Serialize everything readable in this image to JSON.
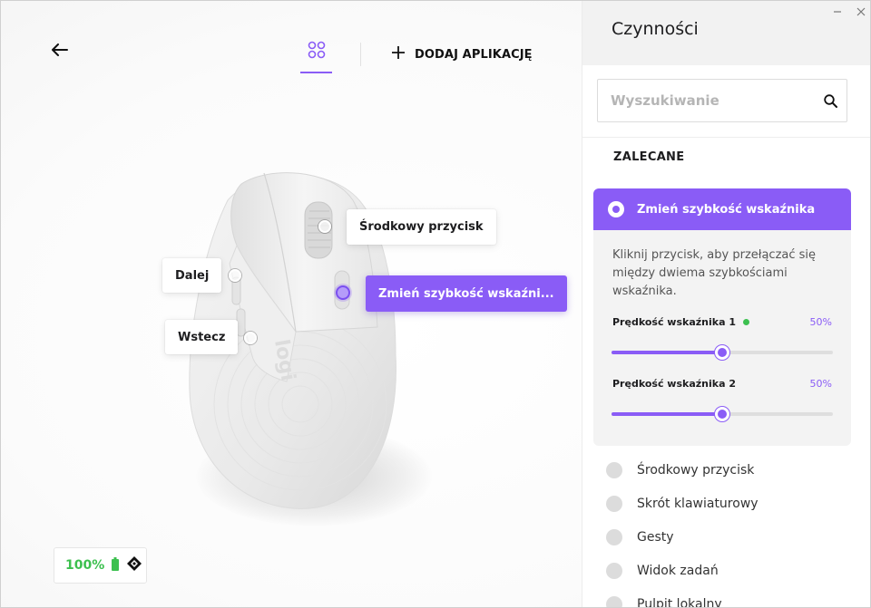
{
  "colors": {
    "accent": "#8a5cf6",
    "battery": "#3cc04f"
  },
  "header": {
    "back_icon": "arrow-left-icon",
    "apps_icon": "grid-circles-icon",
    "add_app_label": "DODAJ APLIKACJĘ"
  },
  "device": {
    "callouts": {
      "middle": "Środkowy przycisk",
      "forward": "Dalej",
      "back": "Wstecz",
      "active": "Zmień szybkość wskaźni..."
    },
    "logo_text": "logi"
  },
  "battery": {
    "percent": "100%"
  },
  "panel": {
    "title": "Czynności",
    "search_placeholder": "Wyszukiwanie",
    "section_label": "ZALECANE",
    "selected": {
      "title": "Zmień szybkość wskaźnika",
      "description": "Kliknij przycisk, aby przełączać się między dwiema szybkościami wskaźnika.",
      "sliders": [
        {
          "label": "Prędkość wskaźnika 1",
          "value_text": "50%",
          "value": 0.5,
          "active": true
        },
        {
          "label": "Prędkość wskaźnika 2",
          "value_text": "50%",
          "value": 0.5,
          "active": false
        }
      ]
    },
    "options": [
      "Środkowy przycisk",
      "Skrót klawiaturowy",
      "Gesty",
      "Widok zadań",
      "Pulpit lokalny"
    ]
  }
}
